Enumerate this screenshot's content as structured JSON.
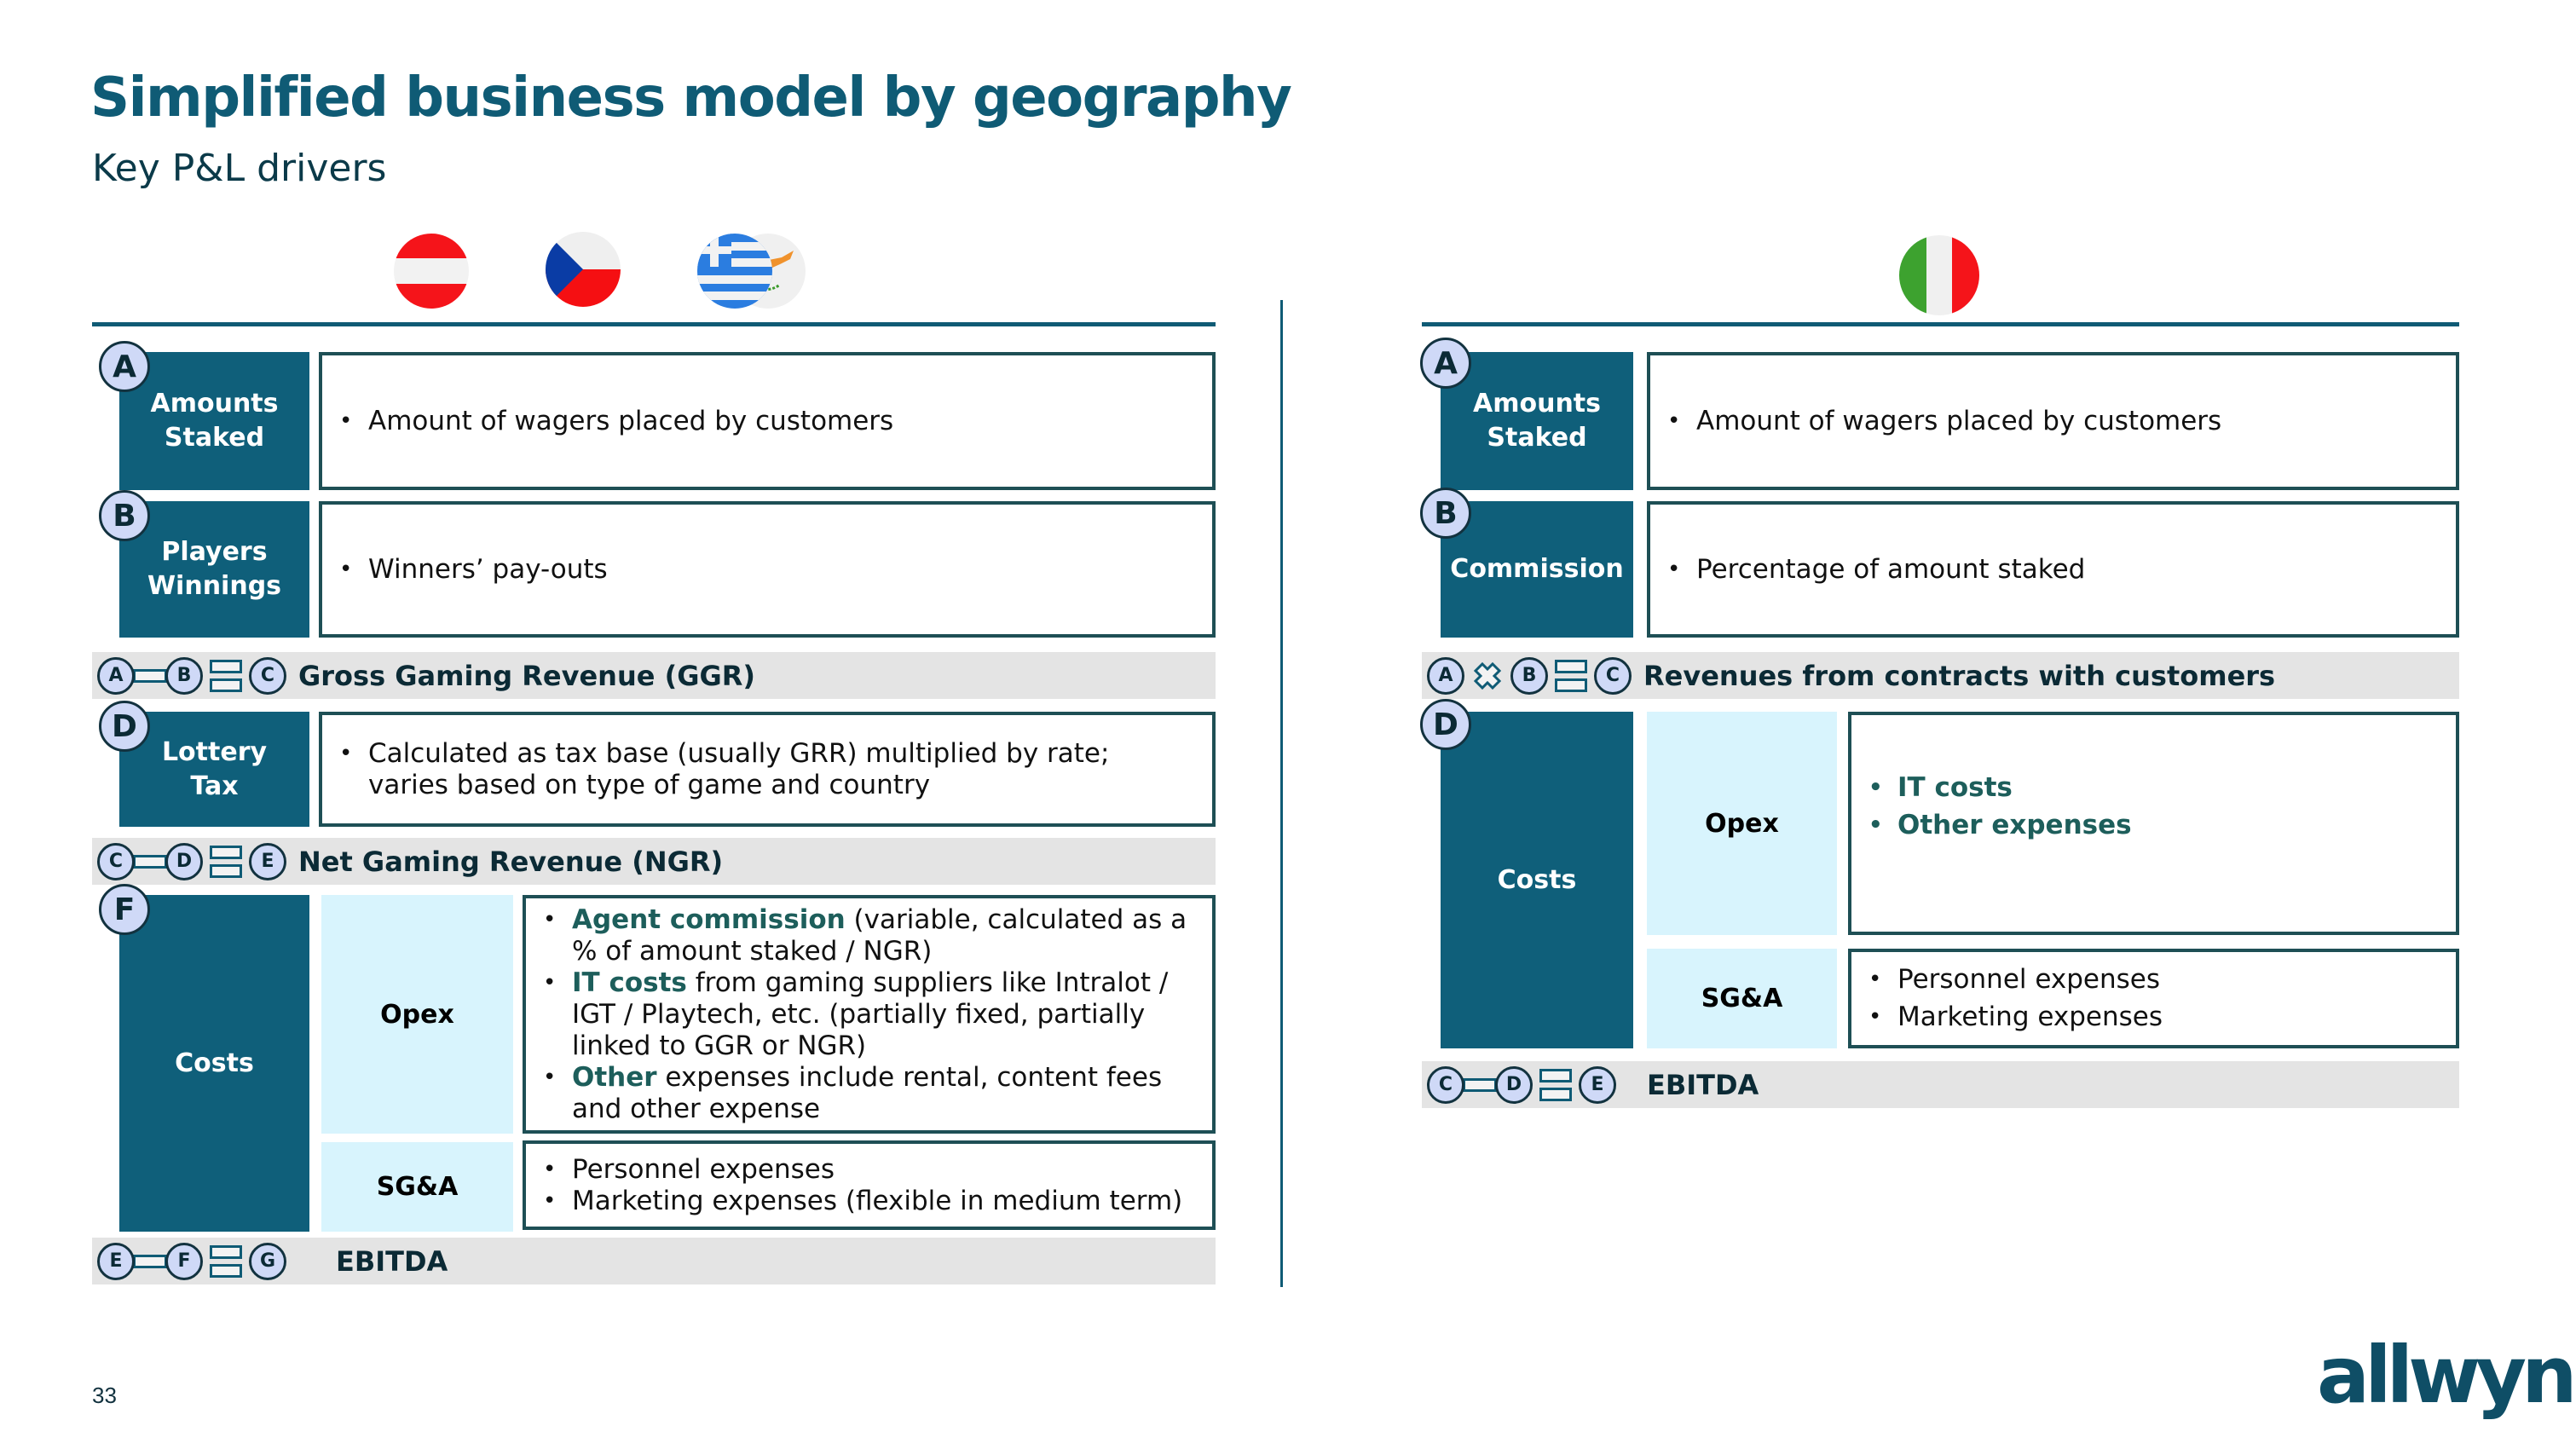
{
  "header": {
    "title": "Simplified business model by geography",
    "subtitle": "Key P&L drivers"
  },
  "left": {
    "flags": [
      "austria-flag",
      "czech-republic-flag",
      "greece-flag",
      "cyprus-flag"
    ],
    "rows": {
      "a": {
        "badge": "A",
        "label_line1": "Amounts",
        "label_line2": "Staked",
        "bullets": [
          "Amount of wagers placed by customers"
        ]
      },
      "b": {
        "badge": "B",
        "label_line1": "Players",
        "label_line2": "Winnings",
        "bullets": [
          "Winners’ pay-outs"
        ]
      },
      "d": {
        "badge": "D",
        "label_line1": "Lottery",
        "label_line2": "Tax",
        "bullets": [
          "Calculated as tax base (usually GRR) multiplied by rate; varies based on type of game and country"
        ]
      },
      "f": {
        "badge": "F",
        "label": "Costs",
        "opex": {
          "label": "Opex",
          "bullets": [
            {
              "highlight": "Agent commission",
              "text": " (variable, calculated as a % of amount staked / NGR)"
            },
            {
              "highlight": "IT costs",
              "text": " from gaming suppliers like Intralot / IGT / Playtech, etc. (partially fixed, partially linked to GGR or NGR)"
            },
            {
              "highlight": "Other",
              "text": " expenses include rental, content fees and other expense"
            }
          ]
        },
        "sga": {
          "label": "SG&A",
          "bullets": [
            "Personnel expenses",
            "Marketing expenses (flexible in medium term)"
          ]
        }
      }
    },
    "formulas": {
      "ggr": {
        "operands": [
          "A",
          "B",
          "C"
        ],
        "operator": "minus",
        "label": "Gross Gaming Revenue (GGR)"
      },
      "ngr": {
        "operands": [
          "C",
          "D",
          "E"
        ],
        "operator": "minus",
        "label": "Net Gaming Revenue (NGR)"
      },
      "ebitda": {
        "operands": [
          "E",
          "F",
          "G"
        ],
        "operator": "minus",
        "label": "EBITDA"
      }
    }
  },
  "right": {
    "flags": [
      "italy-flag"
    ],
    "rows": {
      "a": {
        "badge": "A",
        "label_line1": "Amounts",
        "label_line2": "Staked",
        "bullets": [
          "Amount of wagers placed by customers"
        ]
      },
      "b": {
        "badge": "B",
        "label": "Commission",
        "bullets": [
          "Percentage of amount staked"
        ]
      },
      "d": {
        "badge": "D",
        "label": "Costs",
        "opex": {
          "label": "Opex",
          "bullets": [
            "IT costs",
            "Other expenses"
          ]
        },
        "sga": {
          "label": "SG&A",
          "bullets": [
            "Personnel expenses",
            "Marketing expenses"
          ]
        }
      }
    },
    "formulas": {
      "revenues": {
        "operands": [
          "A",
          "B",
          "C"
        ],
        "operator": "multiply",
        "label": "Revenues from contracts with customers"
      },
      "ebitda": {
        "operands": [
          "C",
          "D",
          "E"
        ],
        "operator": "minus",
        "label": "EBITDA"
      }
    }
  },
  "footer": {
    "page_number": "33",
    "logo_text": "allwyn"
  },
  "colors": {
    "brand_dark": "#0f5f7a",
    "light_fill": "#d8f4fd",
    "badge_fill": "#cfd9f7",
    "bar_fill": "#e4e4e4",
    "highlight_text": "#1d5e5b"
  }
}
